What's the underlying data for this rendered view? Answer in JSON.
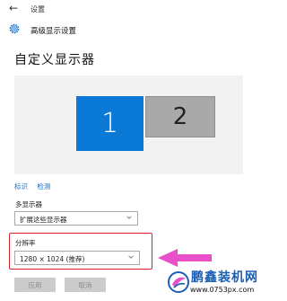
{
  "titlebar": {
    "back_icon": "back-arrow-icon",
    "app_title": "设置"
  },
  "header": {
    "icon": "gear-icon",
    "title": "高级显示设置"
  },
  "page": {
    "title": "自定义显示器"
  },
  "monitors": [
    {
      "label": "1",
      "selected": true,
      "color": "#0a7ad6"
    },
    {
      "label": "2",
      "selected": false,
      "color": "#a9a9a9"
    }
  ],
  "links": {
    "identify": "标识",
    "detect": "检测"
  },
  "multiple_displays": {
    "label": "多显示器",
    "value": "扩展这些显示器"
  },
  "resolution": {
    "label": "分辨率",
    "value": "1280 × 1024 (推荐)"
  },
  "buttons": {
    "apply": "应用",
    "cancel": "取消"
  },
  "watermark": {
    "title": "鹏鑫装机网",
    "url": "www.0753px.com"
  },
  "colors": {
    "accent": "#0a7ad6",
    "highlight_box": "#e0202a",
    "arrow": "#e84fc9"
  }
}
